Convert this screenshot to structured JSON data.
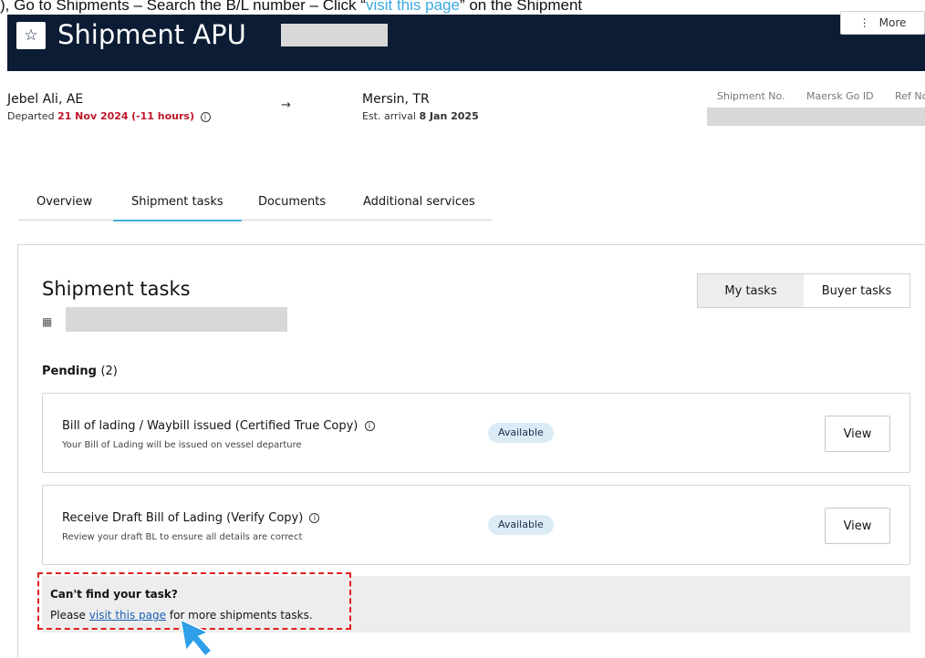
{
  "instruction": {
    "text_before": "), Go to Shipments – Search the B/L number – Click “",
    "link_text": "visit this page",
    "text_after": "” on the Shipment"
  },
  "header": {
    "title": "Shipment APU",
    "more_label": "More"
  },
  "route": {
    "origin": "Jebel Ali, AE",
    "departed_label": "Departed",
    "departed_date": "21 Nov 2024",
    "departed_delta": "(-11 hours)",
    "destination": "Mersin, TR",
    "arrival_label": "Est. arrival",
    "arrival_date": "8 Jan 2025",
    "meta_labels": [
      "Shipment No.",
      "Maersk Go ID",
      "Ref No"
    ]
  },
  "tabs": [
    {
      "label": "Overview"
    },
    {
      "label": "Shipment tasks"
    },
    {
      "label": "Documents"
    },
    {
      "label": "Additional services"
    }
  ],
  "panel": {
    "title": "Shipment tasks",
    "toggle": [
      "My tasks",
      "Buyer tasks"
    ],
    "pending_label": "Pending",
    "pending_count": "(2)"
  },
  "tasks": [
    {
      "title": "Bill of lading / Waybill issued (Certified True Copy)",
      "desc": "Your Bill of Lading will be issued on vessel departure",
      "status": "Available",
      "action": "View"
    },
    {
      "title": "Receive Draft Bill of Lading (Verify Copy)",
      "desc": "Review your draft BL to ensure all details are correct",
      "status": "Available",
      "action": "View"
    }
  ],
  "help": {
    "heading": "Can't find your task?",
    "prefix": "Please",
    "link": "visit this page",
    "suffix": "for more shipments tasks."
  },
  "colors": {
    "header_bg": "#0b1c34",
    "accent_tab": "#42b0d5",
    "badge_bg": "#dbecf7",
    "highlight": "#e02020",
    "departed_red": "#c0172b"
  }
}
